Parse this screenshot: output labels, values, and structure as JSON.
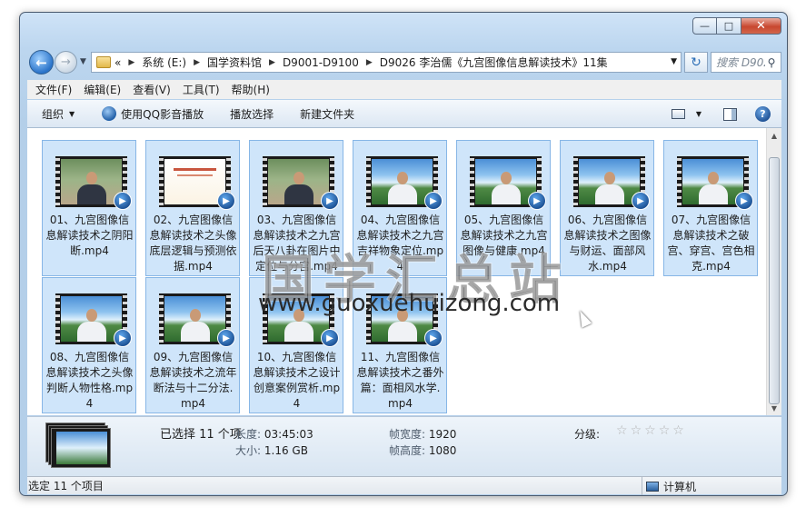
{
  "window": {
    "caption_min": "—",
    "caption_max": "□",
    "caption_close": "✕"
  },
  "nav": {
    "back_glyph": "←",
    "forward_glyph": "→",
    "breadcrumb_prefix": "«",
    "breadcrumbs": [
      "系统 (E:)",
      "国学资料馆",
      "D9001-D9100",
      "D9026 李治儒《九宫图像信息解读技术》11集"
    ],
    "search_placeholder": "搜索 D902...",
    "refresh_glyph": "↻"
  },
  "menu": [
    "文件(F)",
    "编辑(E)",
    "查看(V)",
    "工具(T)",
    "帮助(H)"
  ],
  "toolbar": {
    "organize": "组织",
    "play_with_qq": "使用QQ影音播放",
    "play_selected": "播放选择",
    "new_folder": "新建文件夹",
    "help": "?"
  },
  "files": [
    {
      "label": "01、九宫图像信息解读技术之阴阳断.mp4",
      "thumb": "studio"
    },
    {
      "label": "02、九宫图像信息解读技术之头像底层逻辑与预测依据.mp4",
      "thumb": "slide"
    },
    {
      "label": "03、九宫图像信息解读技术之九宫后天八卦在图片中定位与分宫.mp4",
      "thumb": "studio"
    },
    {
      "label": "04、九宫图像信息解读技术之九宫吉祥物象定位.mp4",
      "thumb": "sky"
    },
    {
      "label": "05、九宫图像信息解读技术之九宫图像与健康.mp4",
      "thumb": "sky"
    },
    {
      "label": "06、九宫图像信息解读技术之图像与财运、面部风水.mp4",
      "thumb": "sky"
    },
    {
      "label": "07、九宫图像信息解读技术之破宫、穿宫、宫色相克.mp4",
      "thumb": "sky"
    },
    {
      "label": "08、九宫图像信息解读技术之头像判断人物性格.mp4",
      "thumb": "sky"
    },
    {
      "label": "09、九宫图像信息解读技术之流年断法与十二分法.mp4",
      "thumb": "sky"
    },
    {
      "label": "10、九宫图像信息解读技术之设计创意案例赏析.mp4",
      "thumb": "sky"
    },
    {
      "label": "11、九宫图像信息解读技术之番外篇：面相风水学.mp4",
      "thumb": "sky"
    }
  ],
  "watermark": {
    "cn": "国学汇总站",
    "url": "www.guoxuehuizong.com"
  },
  "details": {
    "selected": "已选择 11 个项",
    "length_key": "长度:",
    "length_val": "03:45:03",
    "size_key": "大小:",
    "size_val": "1.16 GB",
    "width_key": "帧宽度:",
    "width_val": "1920",
    "height_key": "帧高度:",
    "height_val": "1080",
    "rating_key": "分级:",
    "rating_stars": 0
  },
  "status": {
    "left": "选定 11 个项目",
    "right": "计算机"
  }
}
